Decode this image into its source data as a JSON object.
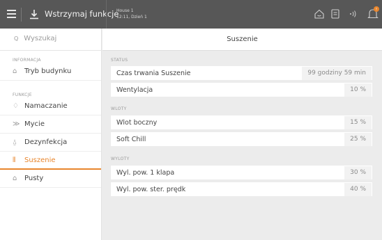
{
  "topbar": {
    "stop_label": "Wstrzymaj funkcje",
    "house_line1": "House 1",
    "house_line2": "12:11, Dzień 1",
    "icons": [
      "menu-icon",
      "stop-icon",
      "home-icon",
      "save-icon",
      "wifi-icon",
      "alarm-bell-icon"
    ],
    "accent": "#e8852c"
  },
  "sidebar": {
    "search_placeholder": "Wyszukaj",
    "section_info": "INFORMACJA",
    "info_items": [
      {
        "label": "Tryb budynku",
        "icon": "building-icon"
      }
    ],
    "section_functions": "FUNKCJE",
    "function_items": [
      {
        "label": "Namaczanie",
        "icon": "drop-icon"
      },
      {
        "label": "Mycie",
        "icon": "wash-icon"
      },
      {
        "label": "Dezynfekcja",
        "icon": "disinfection-icon"
      },
      {
        "label": "Suszenie",
        "icon": "drying-icon",
        "active": true
      },
      {
        "label": "Pusty",
        "icon": "empty-icon"
      }
    ]
  },
  "main": {
    "title": "Suszenie",
    "groups": [
      {
        "label": "STATUS",
        "rows": [
          {
            "label": "Czas trwania Suszenie",
            "value": "99 godziny 59 min"
          },
          {
            "label": "Wentylacja",
            "value": "10 %"
          }
        ]
      },
      {
        "label": "WLOTY",
        "rows": [
          {
            "label": "Wlot boczny",
            "value": "15 %"
          },
          {
            "label": "Soft Chill",
            "value": "25 %"
          }
        ]
      },
      {
        "label": "WYLOTY",
        "rows": [
          {
            "label": "Wyl. pow. 1 klapa",
            "value": "30 %"
          },
          {
            "label": "Wyl. pow. ster. prędk",
            "value": "40 %"
          }
        ]
      }
    ]
  }
}
